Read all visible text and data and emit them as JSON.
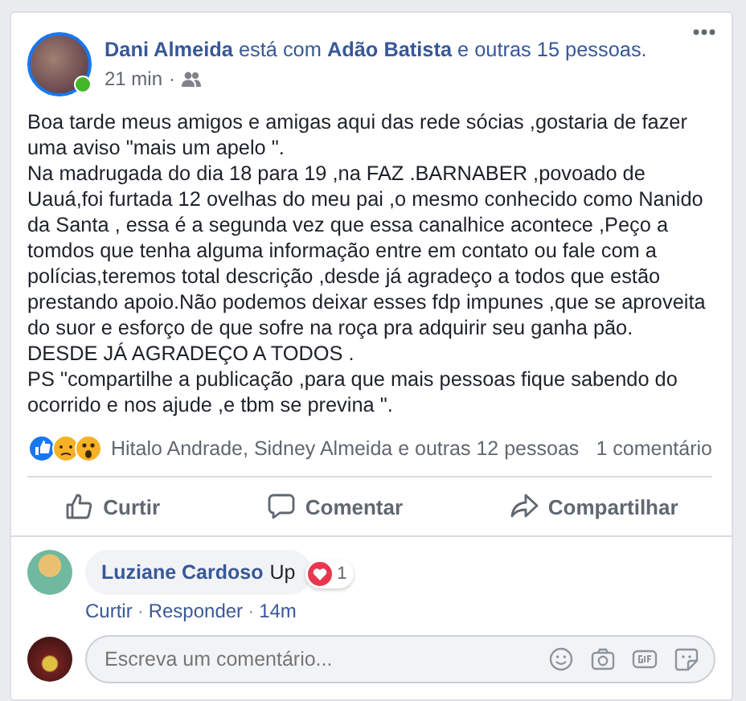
{
  "post": {
    "author": "Dani Almeida",
    "with_text": "está com",
    "tagged": "Adão Batista",
    "others": "e outras 15 pessoas.",
    "online": true,
    "time": "21 min",
    "separator": "·",
    "paragraphs": [
      "Boa tarde meus amigos e amigas aqui das rede sócias ,gostaria de fazer uma aviso \"mais um apelo \".",
      "Na madrugada do dia 18 para 19 ,na FAZ .BARNABER ,povoado de Uauá,foi furtada 12 ovelhas do meu pai ,o mesmo conhecido como Nanido da Santa , essa é a segunda vez que essa canalhice acontece ,Peço a tomdos que tenha alguma informação entre em contato ou fale com a polícias,teremos total descrição ,desde já agradeço a todos que estão prestando apoio.Não podemos deixar esses fdp impunes ,que se aproveita do suor e esforço de que sofre na roça pra adquirir seu ganha pão.",
      "DESDE JÁ AGRADEÇO A TODOS .",
      "PS \"compartilhe a publicação ,para que mais pessoas fique sabendo do ocorrido e nos ajude ,e tbm se previna \"."
    ],
    "reactions_text": "Hitalo Andrade, Sidney Almeida e outras 12 pessoas",
    "comments_count": "1 comentário"
  },
  "actions": [
    {
      "kind": "like",
      "label": "Curtir"
    },
    {
      "kind": "comment",
      "label": "Comentar"
    },
    {
      "kind": "share",
      "label": "Compartilhar"
    }
  ],
  "comments": [
    {
      "author": "Luziane Cardoso",
      "text": "Up",
      "reaction_count": "1",
      "links": [
        "Curtir",
        "Responder"
      ],
      "time": "14m"
    }
  ],
  "composer": {
    "placeholder": "Escreva um comentário..."
  }
}
